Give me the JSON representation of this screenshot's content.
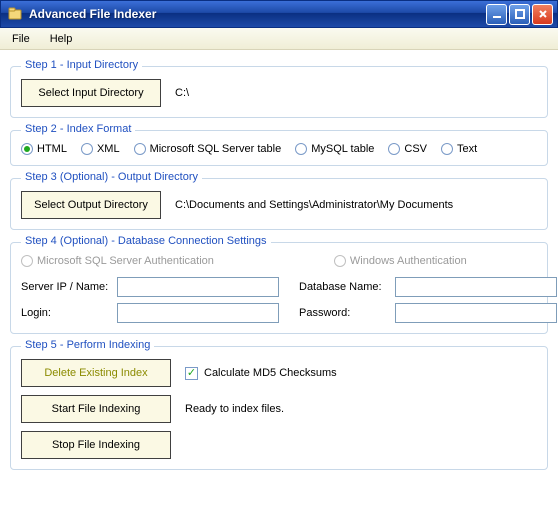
{
  "window": {
    "title": "Advanced File Indexer"
  },
  "menu": {
    "file": "File",
    "help": "Help"
  },
  "step1": {
    "legend": "Step 1 - Input Directory",
    "button": "Select Input Directory",
    "path": "C:\\"
  },
  "step2": {
    "legend": "Step 2 - Index Format",
    "options": {
      "html": "HTML",
      "xml": "XML",
      "mssql": "Microsoft SQL Server table",
      "mysql": "MySQL table",
      "csv": "CSV",
      "text": "Text"
    },
    "selected": "html"
  },
  "step3": {
    "legend": "Step 3 (Optional) - Output Directory",
    "button": "Select Output Directory",
    "path": "C:\\Documents and Settings\\Administrator\\My Documents"
  },
  "step4": {
    "legend": "Step 4 (Optional) - Database Connection Settings",
    "auth_mssql": "Microsoft SQL Server Authentication",
    "auth_windows": "Windows Authentication",
    "server_label": "Server IP / Name:",
    "dbname_label": "Database Name:",
    "login_label": "Login:",
    "password_label": "Password:",
    "server_value": "",
    "dbname_value": "",
    "login_value": "",
    "password_value": ""
  },
  "step5": {
    "legend": "Step 5 - Perform Indexing",
    "delete_button": "Delete Existing Index",
    "md5_label": "Calculate MD5 Checksums",
    "md5_checked": true,
    "start_button": "Start File Indexing",
    "stop_button": "Stop File Indexing",
    "status": "Ready to index files."
  }
}
